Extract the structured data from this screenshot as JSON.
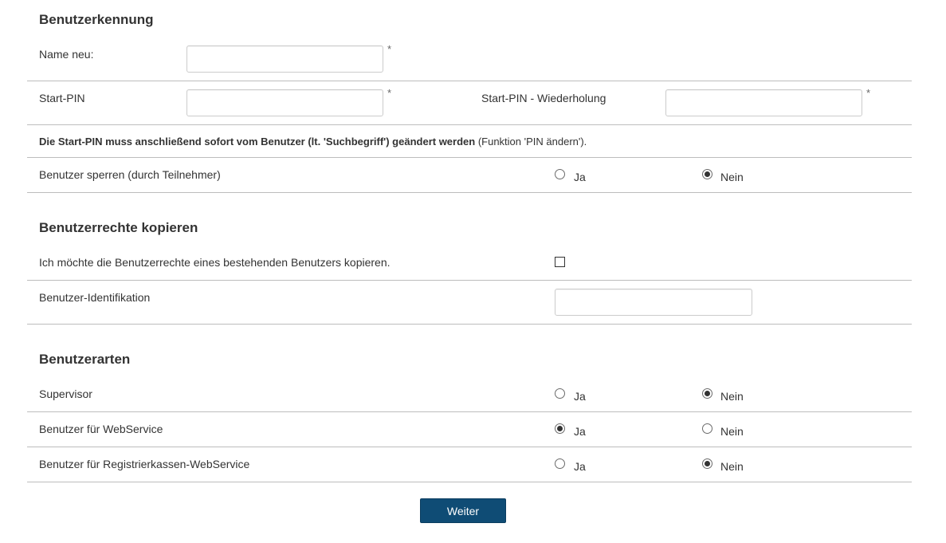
{
  "section_user_id": {
    "title": "Benutzerkennung",
    "name_label": "Name neu:",
    "name_value": "",
    "pin_label": "Start-PIN",
    "pin_value": "",
    "pin_repeat_label": "Start-PIN - Wiederholung",
    "pin_repeat_value": "",
    "required_marker": "*",
    "note_bold": "Die Start-PIN muss anschließend sofort vom Benutzer (lt. 'Suchbegriff') geändert werden",
    "note_rest": " (Funktion 'PIN ändern').",
    "lock_label": "Benutzer sperren (durch Teilnehmer)",
    "lock_yes": "Ja",
    "lock_no": "Nein",
    "lock_selected": "Nein"
  },
  "section_copy_rights": {
    "title": "Benutzerrechte kopieren",
    "copy_label": "Ich möchte die Benutzerrechte eines bestehenden Benutzers kopieren.",
    "copy_checked": false,
    "user_id_label": "Benutzer-Identifikation",
    "user_id_value": ""
  },
  "section_user_types": {
    "title": "Benutzerarten",
    "rows": [
      {
        "label": "Supervisor",
        "yes": "Ja",
        "no": "Nein",
        "selected": "Nein"
      },
      {
        "label": "Benutzer für WebService",
        "yes": "Ja",
        "no": "Nein",
        "selected": "Ja"
      },
      {
        "label": "Benutzer für Registrierkassen-WebService",
        "yes": "Ja",
        "no": "Nein",
        "selected": "Nein"
      }
    ]
  },
  "actions": {
    "next_label": "Weiter"
  },
  "colors": {
    "button_bg": "#0f4c75",
    "divider": "#bdbdbd"
  }
}
